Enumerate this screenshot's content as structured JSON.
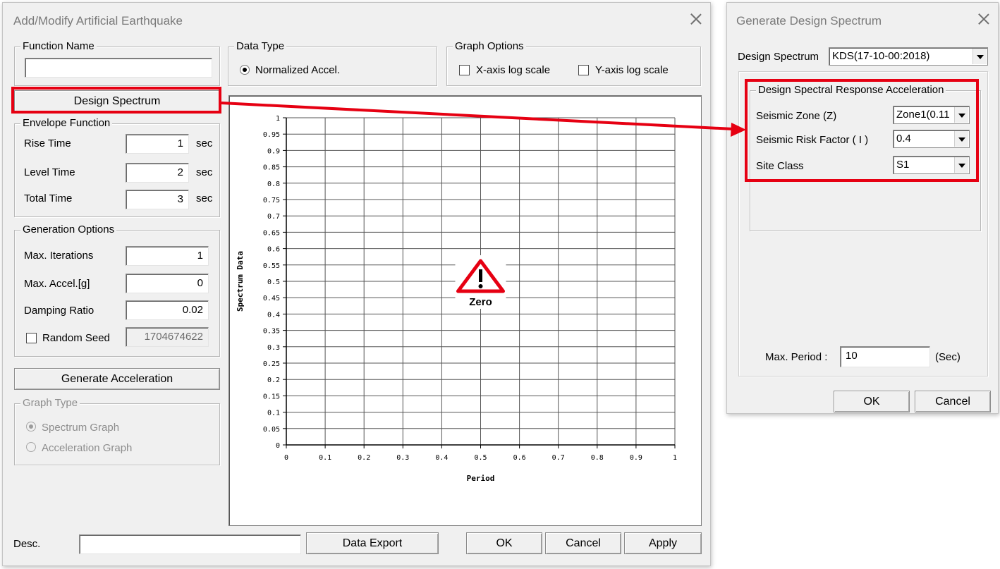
{
  "main_dialog": {
    "title": "Add/Modify Artificial Earthquake",
    "function_name": {
      "legend": "Function Name",
      "value": ""
    },
    "data_type": {
      "legend": "Data Type",
      "option": "Normalized Accel.",
      "selected": true
    },
    "graph_options": {
      "legend": "Graph Options",
      "x_log": "X-axis log scale",
      "y_log": "Y-axis log scale",
      "x_log_checked": false,
      "y_log_checked": false
    },
    "design_spectrum_button": "Design Spectrum",
    "envelope": {
      "legend": "Envelope Function",
      "rows": [
        {
          "label": "Rise Time",
          "value": "1",
          "unit": "sec"
        },
        {
          "label": "Level Time",
          "value": "2",
          "unit": "sec"
        },
        {
          "label": "Total Time",
          "value": "3",
          "unit": "sec"
        }
      ]
    },
    "generation": {
      "legend": "Generation Options",
      "max_iterations_label": "Max. Iterations",
      "max_iterations": "1",
      "max_accel_label": "Max. Accel.[g]",
      "max_accel": "0",
      "damping_label": "Damping Ratio",
      "damping": "0.02",
      "random_seed_label": "Random Seed",
      "random_seed": "1704674622",
      "random_seed_checked": false
    },
    "generate_button": "Generate Acceleration",
    "graph_type": {
      "legend": "Graph Type",
      "spectrum": "Spectrum Graph",
      "acceleration": "Acceleration Graph",
      "selected": "spectrum"
    },
    "desc_label": "Desc.",
    "desc_value": "",
    "data_export": "Data Export",
    "ok": "OK",
    "cancel": "Cancel",
    "apply": "Apply"
  },
  "chart_data": {
    "type": "line",
    "xlabel": "Period",
    "ylabel": "Spectrum Data",
    "xlim": [
      0,
      1
    ],
    "ylim": [
      0,
      1
    ],
    "xticks": [
      "0",
      "0.1",
      "0.2",
      "0.3",
      "0.4",
      "0.5",
      "0.6",
      "0.7",
      "0.8",
      "0.9",
      "1"
    ],
    "yticks": [
      "0",
      "0.05",
      "0.1",
      "0.15",
      "0.2",
      "0.25",
      "0.3",
      "0.35",
      "0.4",
      "0.45",
      "0.5",
      "0.55",
      "0.6",
      "0.65",
      "0.7",
      "0.75",
      "0.8",
      "0.85",
      "0.9",
      "0.95",
      "1"
    ],
    "grid": true,
    "series": [],
    "warning_label": "Zero"
  },
  "spectrum_dialog": {
    "title": "Generate Design Spectrum",
    "design_spectrum_label": "Design Spectrum",
    "design_spectrum_value": "KDS(17-10-00:2018)",
    "group_legend": "Design Spectral Response Acceleration",
    "seismic_zone_label": "Seismic Zone (Z)",
    "seismic_zone_value": "Zone1(0.11",
    "risk_factor_label": "Seismic Risk Factor ( I )",
    "risk_factor_value": "0.4",
    "site_class_label": "Site Class",
    "site_class_value": "S1",
    "max_period_label": "Max. Period :",
    "max_period_value": "10",
    "max_period_unit": "(Sec)",
    "ok": "OK",
    "cancel": "Cancel"
  },
  "annotation": {
    "highlight_color": "#e60012",
    "arrow_color": "#e60012"
  }
}
